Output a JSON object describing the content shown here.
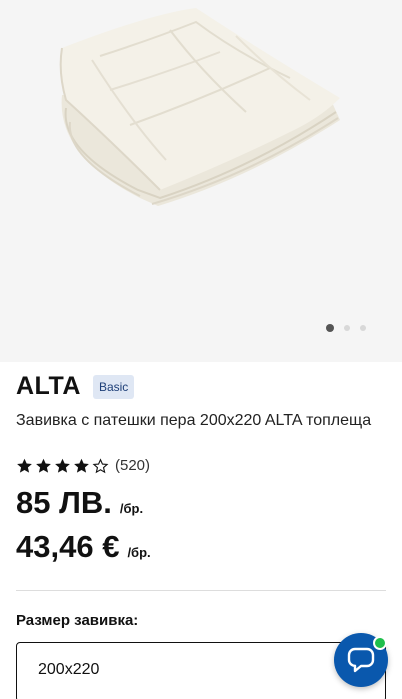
{
  "gallery": {
    "image_alt": "ALTA завивка",
    "slide_count": 3,
    "active_slide": 1
  },
  "product": {
    "brand": "ALTA",
    "badge": "Basic",
    "description": "Завивка с патешки пера 200x220 ALTA топлеща",
    "rating": 4,
    "rating_max": 5,
    "reviews": "(520)",
    "price_bgn": "85 ЛВ.",
    "price_bgn_unit": "/бр.",
    "price_eur": "43,46 €",
    "price_eur_unit": "/бр."
  },
  "size": {
    "label": "Размер завивка:",
    "value": "200x220"
  },
  "chat": {
    "icon": "chat-icon",
    "status_color": "#1fbf4c",
    "button_color": "#0a58ad"
  }
}
